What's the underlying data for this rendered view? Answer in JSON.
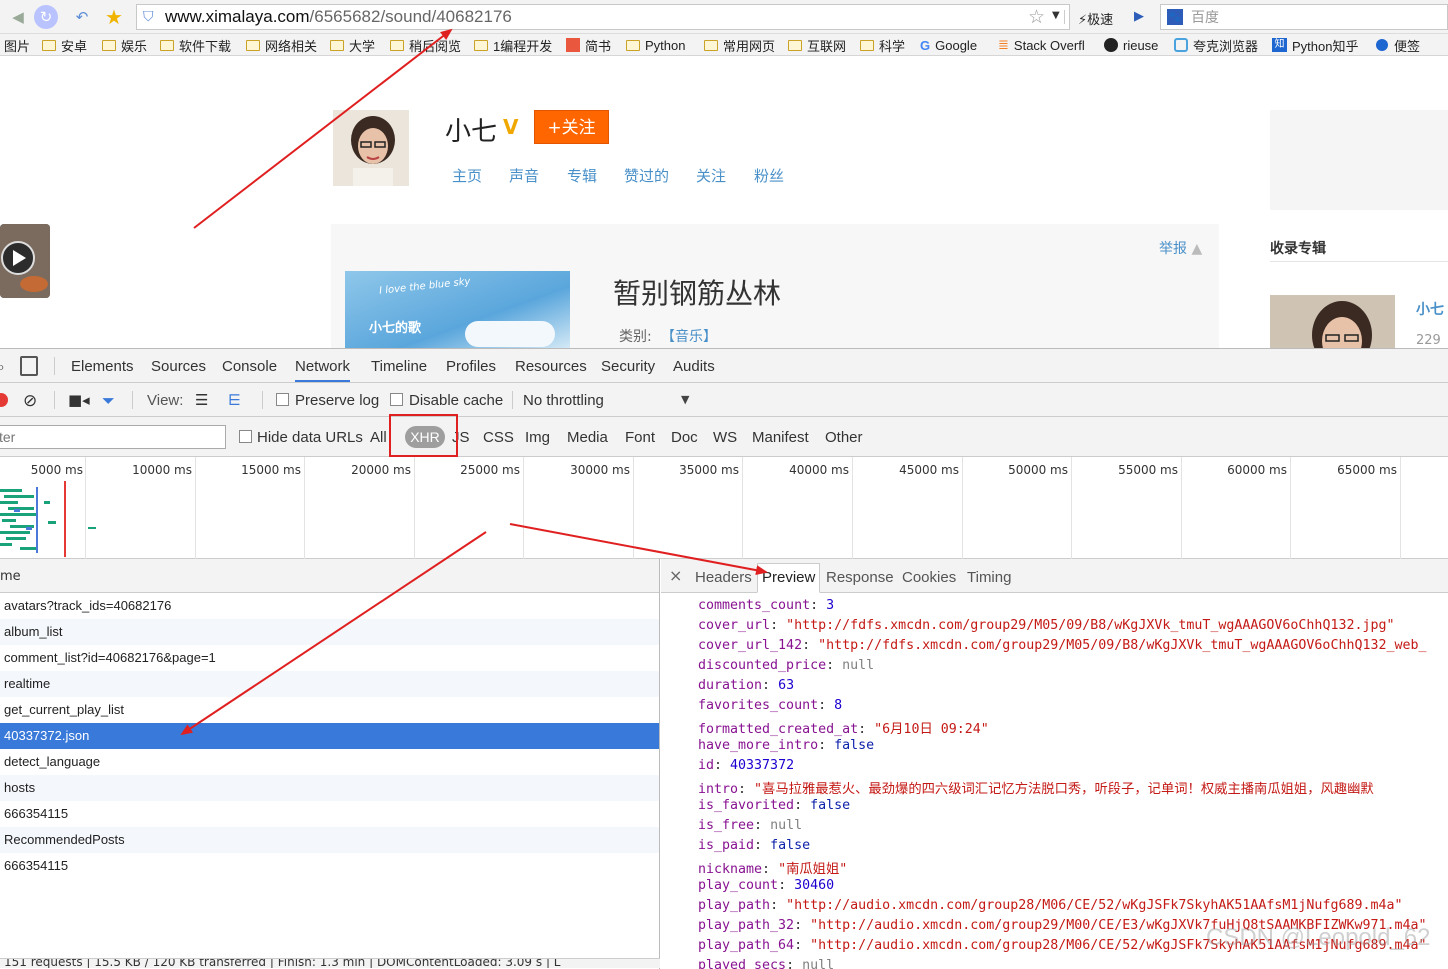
{
  "browser": {
    "url_host": "www.ximalaya.com",
    "url_path": "/6565682/sound/40682176",
    "search_placeholder": "百度",
    "speed_label": "极速",
    "bookmarks": [
      "图片",
      "安卓",
      "娱乐",
      "软件下载",
      "网络相关",
      "大学",
      "稍后阅览",
      "1编程开发",
      "简书",
      "Python",
      "常用网页",
      "互联网",
      "科学",
      "Google",
      "Stack Overfl",
      "rieuse",
      "夸克浏览器",
      "Python知乎",
      "便签"
    ]
  },
  "page": {
    "username": "小七",
    "follow_label": "+关注",
    "nav_tabs": [
      "主页",
      "声音",
      "专辑",
      "赞过的",
      "关注",
      "粉丝"
    ],
    "report_label": "举报",
    "sound_title": "暂别钢筋丛林",
    "category_label": "类别:",
    "category_value": "【音乐】",
    "cover_text": "I love the blue sky",
    "cover_subtext": "小七的歌",
    "sidebar_title": "收录专辑",
    "sidebar_user": "小七",
    "sidebar_count": "229"
  },
  "devtools": {
    "tabs": [
      "Elements",
      "Sources",
      "Console",
      "Network",
      "Timeline",
      "Profiles",
      "Resources",
      "Security",
      "Audits"
    ],
    "active_tab": "Network",
    "toolbar": {
      "view_label": "View:",
      "preserve_log": "Preserve log",
      "disable_cache": "Disable cache",
      "throttling": "No throttling"
    },
    "filter": {
      "placeholder": "ter",
      "hide_data_urls": "Hide data URLs",
      "types": [
        "All",
        "XHR",
        "JS",
        "CSS",
        "Img",
        "Media",
        "Font",
        "Doc",
        "WS",
        "Manifest",
        "Other"
      ],
      "active_type": "XHR"
    },
    "timeline_ticks": [
      "5000 ms",
      "10000 ms",
      "15000 ms",
      "20000 ms",
      "25000 ms",
      "30000 ms",
      "35000 ms",
      "40000 ms",
      "45000 ms",
      "50000 ms",
      "55000 ms",
      "60000 ms",
      "65000 ms"
    ],
    "requests_header": "me",
    "requests": [
      "avatars?track_ids=40682176",
      "album_list",
      "comment_list?id=40682176&page=1",
      "realtime",
      "get_current_play_list",
      "40337372.json",
      "detect_language",
      "hosts",
      "666354115",
      "RecommendedPosts",
      "666354115"
    ],
    "selected_request": "40337372.json",
    "detail_tabs": [
      "Headers",
      "Preview",
      "Response",
      "Cookies",
      "Timing"
    ],
    "active_detail_tab": "Preview",
    "preview": [
      {
        "key": "comments_count",
        "value": "3",
        "type": "number"
      },
      {
        "key": "cover_url",
        "value": "\"http://fdfs.xmcdn.com/group29/M05/09/B8/wKgJXVk_tmuT_wgAAAGOV6oChhQ132.jpg\"",
        "type": "string"
      },
      {
        "key": "cover_url_142",
        "value": "\"http://fdfs.xmcdn.com/group29/M05/09/B8/wKgJXVk_tmuT_wgAAAGOV6oChhQ132_web_",
        "type": "string"
      },
      {
        "key": "discounted_price",
        "value": "null",
        "type": "null"
      },
      {
        "key": "duration",
        "value": "63",
        "type": "number"
      },
      {
        "key": "favorites_count",
        "value": "8",
        "type": "number"
      },
      {
        "key": "formatted_created_at",
        "value": "\"6月10日 09:24\"",
        "type": "string"
      },
      {
        "key": "have_more_intro",
        "value": "false",
        "type": "bool"
      },
      {
        "key": "id",
        "value": "40337372",
        "type": "number"
      },
      {
        "key": "intro",
        "value": "\"喜马拉雅最惹火、最劲爆的四六级词汇记忆方法脱口秀，听段子，记单词！权威主播南瓜姐姐，风趣幽默",
        "type": "string"
      },
      {
        "key": "is_favorited",
        "value": "false",
        "type": "bool"
      },
      {
        "key": "is_free",
        "value": "null",
        "type": "null"
      },
      {
        "key": "is_paid",
        "value": "false",
        "type": "bool"
      },
      {
        "key": "nickname",
        "value": "\"南瓜姐姐\"",
        "type": "string"
      },
      {
        "key": "play_count",
        "value": "30460",
        "type": "number"
      },
      {
        "key": "play_path",
        "value": "\"http://audio.xmcdn.com/group28/M06/CE/52/wKgJSFk7SkyhAK51AAfsM1jNufg689.m4a\"",
        "type": "string"
      },
      {
        "key": "play_path_32",
        "value": "\"http://audio.xmcdn.com/group29/M00/CE/E3/wKgJXVk7fuHjQ8tSAAMKBFIZWKw971.m4a\"",
        "type": "string"
      },
      {
        "key": "play_path_64",
        "value": "\"http://audio.xmcdn.com/group28/M06/CE/52/wKgJSFk7SkyhAK51AAfsM1jNufg689.m4a\"",
        "type": "string"
      },
      {
        "key": "played_secs",
        "value": "null",
        "type": "null"
      }
    ],
    "status_text": "151 requests | 15.5 KB / 120 KB transferred | Finish: 1.3 min | DOMContentLoaded: 3.09 s | L"
  },
  "colors": {
    "accent_blue": "#3879d9",
    "follow_orange": "#ff6600",
    "annotation_red": "#e02020",
    "link_blue": "#4a90c8"
  },
  "watermark": "CSDN @Leopold_62"
}
